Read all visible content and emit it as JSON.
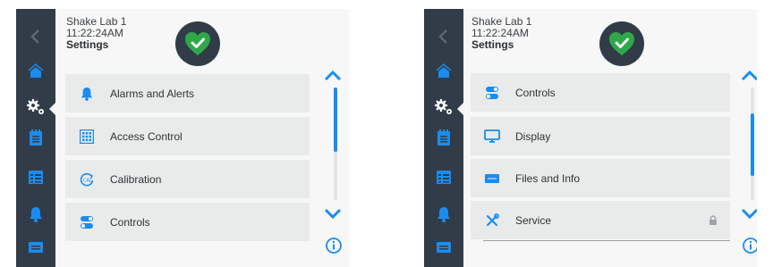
{
  "colors": {
    "sidebar": "#313c48",
    "accent": "#1a8cf0",
    "ok_green": "#2fa84a",
    "item_bg": "#e8ebe9"
  },
  "screens": [
    {
      "header": {
        "name": "Shake Lab 1",
        "time": "11:22:24AM",
        "title": "Settings"
      },
      "status": "ok-check-heart-icon",
      "scroll_position": "top",
      "items": [
        {
          "label": "Alarms and Alerts",
          "icon": "bell-icon",
          "locked": false
        },
        {
          "label": "Access Control",
          "icon": "keypad-icon",
          "locked": false
        },
        {
          "label": "Calibration",
          "icon": "calibration-icon",
          "locked": false
        },
        {
          "label": "Controls",
          "icon": "toggle-icon",
          "locked": false
        }
      ]
    },
    {
      "header": {
        "name": "Shake Lab 1",
        "time": "11:22:24AM",
        "title": "Settings"
      },
      "status": "ok-check-heart-icon",
      "scroll_position": "middle",
      "items": [
        {
          "label": "Controls",
          "icon": "toggle-icon",
          "locked": false
        },
        {
          "label": "Display",
          "icon": "monitor-icon",
          "locked": false
        },
        {
          "label": "Files and Info",
          "icon": "card-icon",
          "locked": false
        },
        {
          "label": "Service",
          "icon": "tools-icon",
          "locked": true
        }
      ]
    }
  ],
  "sidebar": [
    "back-icon",
    "home-icon",
    "settings-icon",
    "notes-icon",
    "calendar-icon",
    "bell-icon",
    "card-icon"
  ],
  "active_nav": "settings-icon"
}
